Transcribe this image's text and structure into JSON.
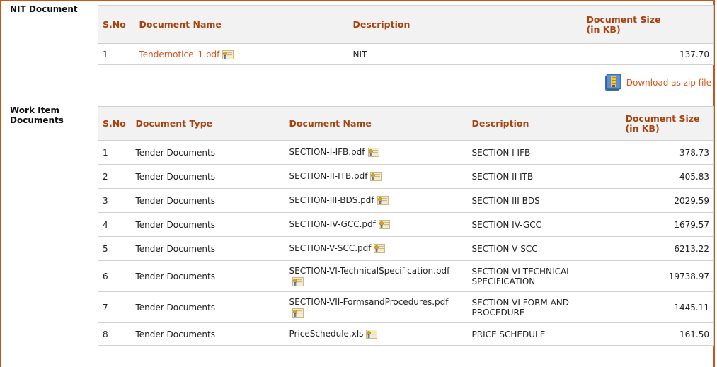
{
  "nit": {
    "label": "NIT Document",
    "headers": {
      "sno": "S.No",
      "name": "Document Name",
      "desc": "Description",
      "size_l1": "Document Size",
      "size_l2": "(in KB)"
    },
    "rows": [
      {
        "sno": "1",
        "name": "Tendernotice_1.pdf",
        "desc": "NIT",
        "size": "137.70"
      }
    ]
  },
  "download": {
    "label": "Download as zip file",
    "icon": "zip-archive-icon"
  },
  "work": {
    "label_l1": "Work Item",
    "label_l2": "Documents",
    "headers": {
      "sno": "S.No",
      "type": "Document Type",
      "name": "Document Name",
      "desc": "Description",
      "size_l1": "Document Size",
      "size_l2": "(in KB)"
    },
    "rows": [
      {
        "sno": "1",
        "type": "Tender Documents",
        "name": "SECTION-I-IFB.pdf",
        "desc": "SECTION I IFB",
        "size": "378.73"
      },
      {
        "sno": "2",
        "type": "Tender Documents",
        "name": "SECTION-II-ITB.pdf",
        "desc": "SECTION II ITB",
        "size": "405.83"
      },
      {
        "sno": "3",
        "type": "Tender Documents",
        "name": "SECTION-III-BDS.pdf",
        "desc": "SECTION III BDS",
        "size": "2029.59"
      },
      {
        "sno": "4",
        "type": "Tender Documents",
        "name": "SECTION-IV-GCC.pdf",
        "desc": "SECTION IV-GCC",
        "size": "1679.57"
      },
      {
        "sno": "5",
        "type": "Tender Documents",
        "name": "SECTION-V-SCC.pdf",
        "desc": "SECTION V SCC",
        "size": "6213.22"
      },
      {
        "sno": "6",
        "type": "Tender Documents",
        "name": "SECTION-VI-TechnicalSpecification.pdf",
        "desc": "SECTION VI TECHNICAL SPECIFICATION",
        "size": "19738.97"
      },
      {
        "sno": "7",
        "type": "Tender Documents",
        "name": "SECTION-VII-FormsandProcedures.pdf",
        "desc": "SECTION VI FORM AND PROCEDURE",
        "size": "1445.11"
      },
      {
        "sno": "8",
        "type": "Tender Documents",
        "name": "PriceSchedule.xls",
        "desc": "PRICE SCHEDULE",
        "size": "161.50"
      }
    ]
  },
  "colors": {
    "accent": "#d2561c",
    "header_text": "#a8420f",
    "border": "#c8561a",
    "header_bg": "#f2f2f2"
  }
}
